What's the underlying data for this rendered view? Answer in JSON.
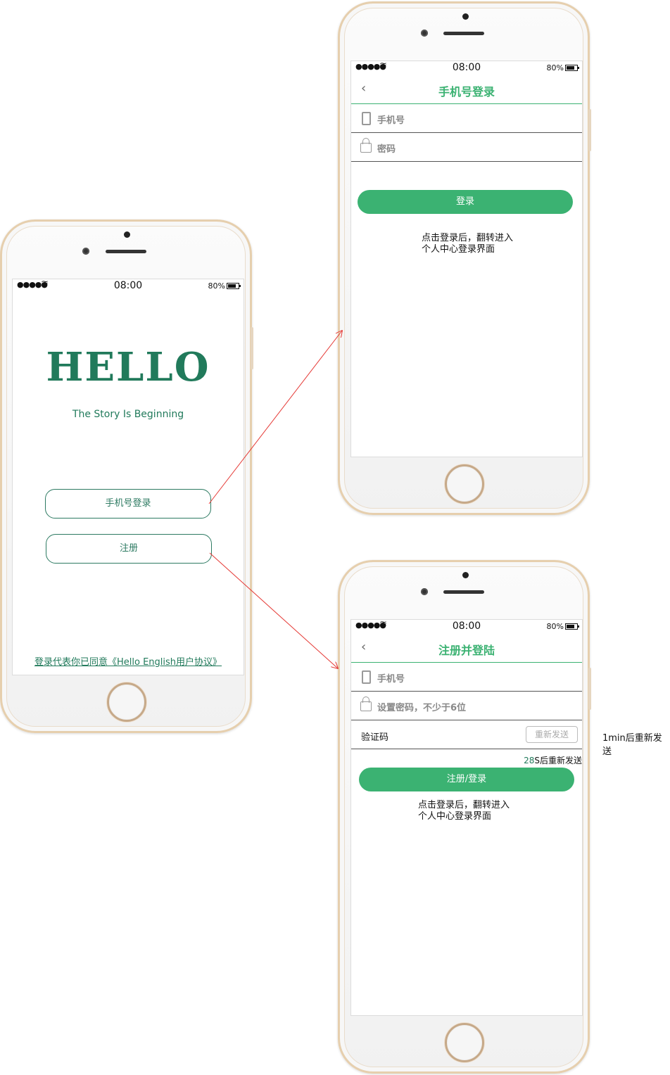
{
  "status_bar": {
    "signal": "●●●●●",
    "wifi": "📶",
    "time": "08:00",
    "battery": "80%"
  },
  "home_screen": {
    "hello": "HELLO",
    "subtitle": "The Story Is Beginning",
    "phone_login_button": "手机号登录",
    "register_button": "注册",
    "agreement": "登录代表你已同意《Hello English用户协议》"
  },
  "login_screen": {
    "back": "‹",
    "title": "手机号登录",
    "phone_placeholder": "手机号",
    "password_placeholder": "密码",
    "login_button": "登录",
    "note_line1": "点击登录后，翻转进入",
    "note_line2": "个人中心登录界面"
  },
  "register_screen": {
    "back": "‹",
    "title": "注册并登陆",
    "phone_placeholder": "手机号",
    "password_placeholder": "设置密码，不少于6位",
    "code_label": "验证码",
    "resend_button": "重新发送",
    "countdown_number": "28",
    "countdown_text": "S后重新发送",
    "submit_button": "注册/登录",
    "note_line1": "点击登录后，翻转进入",
    "note_line2": "个人中心登录界面"
  },
  "annotation": "1min后重新发送",
  "colors": {
    "accent": "#3bb272",
    "dark_green": "#217a5b",
    "arrow": "#e53935",
    "bezel": "#e6cfae"
  }
}
